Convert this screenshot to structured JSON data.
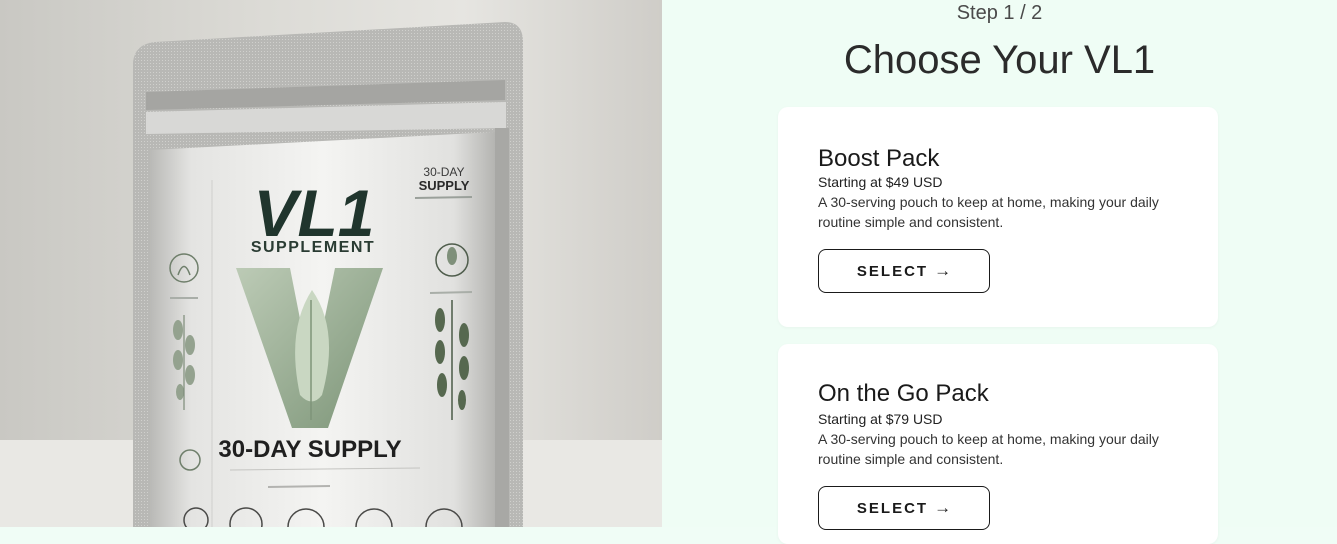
{
  "product_image": {
    "brand": "VL1",
    "subtitle": "SUPPLEMENT",
    "corner_text_1": "30-DAY",
    "corner_text_2": "SUPPLY",
    "supply_text": "30-DAY SUPPLY",
    "icons": [
      "herb-icon",
      "leaf-icon",
      "sprout-icon"
    ]
  },
  "checkout": {
    "step": "Step 1 / 2",
    "title": "Choose Your VL1",
    "packs": [
      {
        "name": "Boost Pack",
        "price": "Starting at $49 USD",
        "description": "A 30-serving pouch to keep at home, making your daily routine simple and consistent.",
        "button": "SELECT",
        "button_icon": "→"
      },
      {
        "name": "On the Go Pack",
        "price": "Starting at $79 USD",
        "description": "A 30-serving pouch to keep at home, making your daily routine simple and consistent.",
        "button": "SELECT",
        "button_icon": "→"
      }
    ]
  },
  "colors": {
    "panel_bg": "#effdf5",
    "card_bg": "#ffffff",
    "text": "#1a1a1a"
  }
}
